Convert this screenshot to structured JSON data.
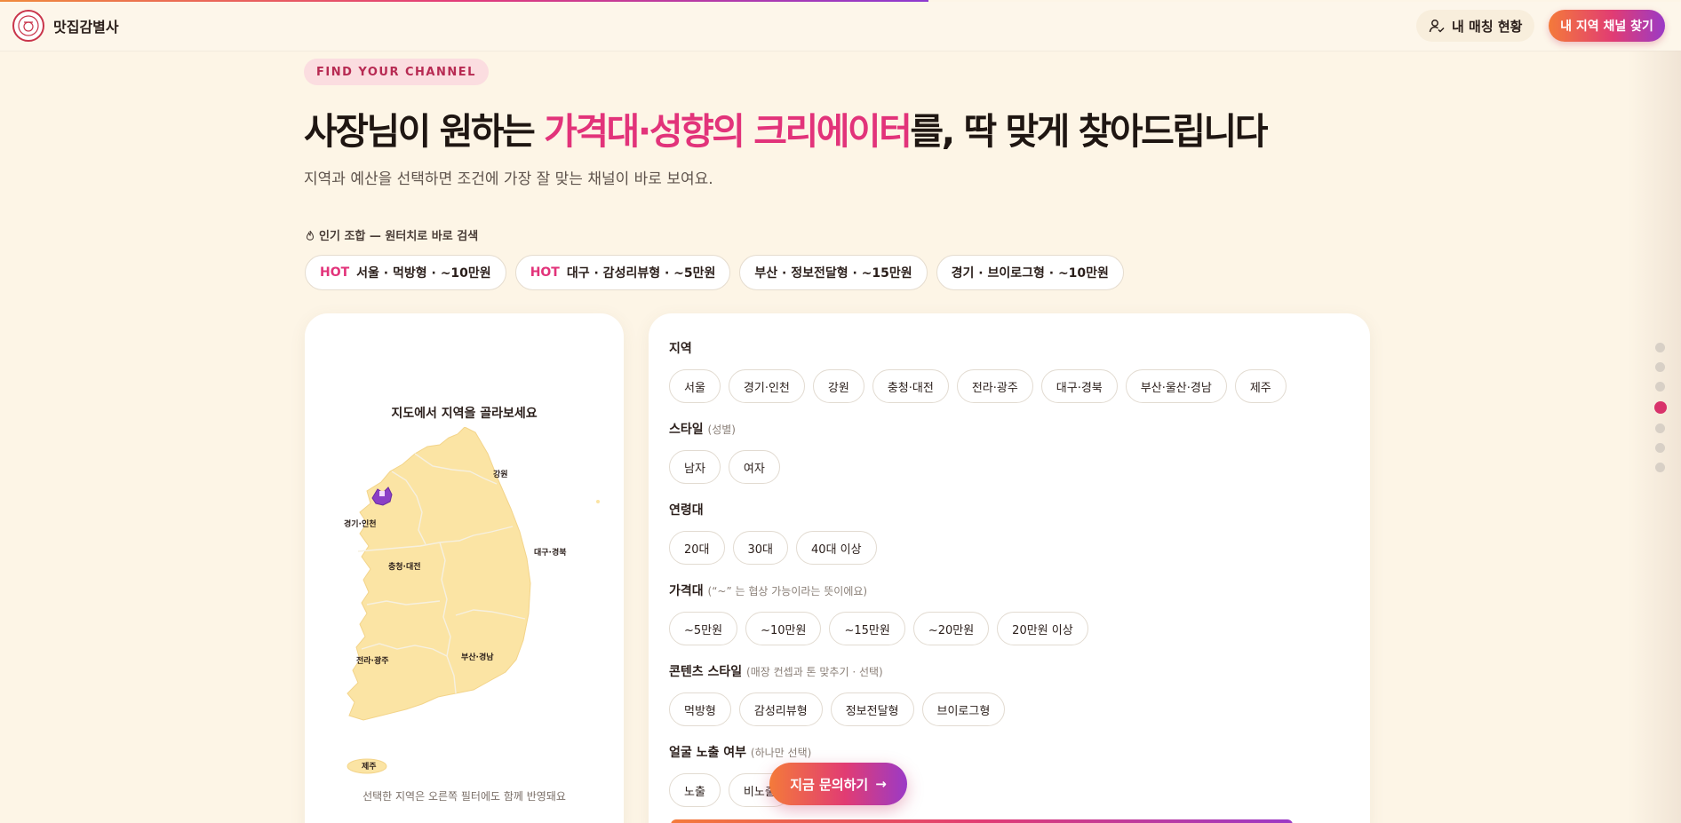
{
  "header": {
    "brand_name": "맛집감별사",
    "match_status_label": "내 매칭 현황",
    "find_channel_button": "내 지역 채널 찾기"
  },
  "hero": {
    "eyebrow": "FIND YOUR CHANNEL",
    "headline_pre": "사장님이 원하는 ",
    "headline_accent": "가격대·성향의 크리에이터",
    "headline_post": "를, 딱 맞게 찾아드립니다",
    "subcopy": "지역과 예산을 선택하면 조건에 가장 잘 맞는 채널이 바로 보여요."
  },
  "popular": {
    "label": "인기 조합 — 원터치로 바로 검색",
    "presets": [
      {
        "hot": "HOT",
        "text": "서울 · 먹방형 · ~10만원"
      },
      {
        "hot": "HOT",
        "text": "대구 · 감성리뷰형 · ~5만원"
      },
      {
        "hot": "",
        "text": "부산 · 정보전달형 · ~15만원"
      },
      {
        "hot": "",
        "text": "경기 · 브이로그형 · ~10만원"
      }
    ]
  },
  "map": {
    "title": "지도에서 지역을 골라보세요",
    "note": "선택한 지역은 오른쪽 필터에도 함께 반영돼요",
    "labels": {
      "gangwon": "강원",
      "gyeonggi": "경기·인천",
      "daegu": "대구·경북",
      "chungcheong": "충청·대전",
      "jeolla": "전라·광주",
      "busan": "부산·경남",
      "jeju": "제주"
    },
    "fill_color": "#fbe4a4",
    "selected_color": "#8b3fc6"
  },
  "filters": {
    "region": {
      "label": "지역",
      "options": [
        "서울",
        "경기·인천",
        "강원",
        "충청·대전",
        "전라·광주",
        "대구·경북",
        "부산·울산·경남",
        "제주"
      ]
    },
    "style": {
      "label": "스타일",
      "hint": "(성별)",
      "options": [
        "남자",
        "여자"
      ]
    },
    "age": {
      "label": "연령대",
      "options": [
        "20대",
        "30대",
        "40대 이상"
      ]
    },
    "price": {
      "label": "가격대",
      "hint": "(“~” 는 협상 가능이라는 뜻이에요)",
      "options": [
        "~5만원",
        "~10만원",
        "~15만원",
        "~20만원",
        "20만원 이상"
      ]
    },
    "content": {
      "label": "콘텐츠 스타일",
      "hint": "(매장 컨셉과 톤 맞추기 · 선택)",
      "options": [
        "먹방형",
        "감성리뷰형",
        "정보전달형",
        "브이로그형"
      ]
    },
    "face": {
      "label": "얼굴 노출 여부",
      "hint": "(하나만 선택)",
      "options": [
        "노출",
        "비노출"
      ]
    }
  },
  "floating_cta": {
    "label": "지금 문의하기",
    "arrow": "→"
  },
  "colors": {
    "accent": "#e2337a",
    "background": "#fdf5e6",
    "gradient_start": "#f47a3a",
    "gradient_end": "#9b3ac6"
  }
}
